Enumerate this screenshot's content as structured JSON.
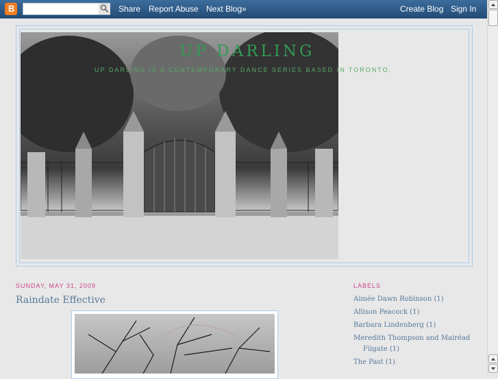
{
  "navbar": {
    "search_value": "",
    "links": [
      {
        "label": "Share"
      },
      {
        "label": "Report Abuse"
      },
      {
        "label": "Next Blog»"
      }
    ],
    "right_links": [
      {
        "label": "Create Blog"
      },
      {
        "label": "Sign In"
      }
    ],
    "logo_letter": "B"
  },
  "header": {
    "title": "UP DARLING",
    "description": "UP DARLING IS A CONTEMPORARY DANCE SERIES BASED IN TORONTO."
  },
  "post": {
    "date": "SUNDAY, MAY 31, 2009",
    "title": "Raindate Effective"
  },
  "sidebar": {
    "heading": "LABELS",
    "labels": [
      {
        "name": "Aimée Dawn Robinson",
        "count": "(1)"
      },
      {
        "name": "Allison Peacock",
        "count": "(1)"
      },
      {
        "name": "Barbara Lindenberg",
        "count": "(1)"
      },
      {
        "name": "Meredith Thompson and Mairéad",
        "name2": "Filgate",
        "count": "(1)"
      },
      {
        "name": "The Past",
        "count": "(1)"
      }
    ]
  },
  "colors": {
    "title": "#339955",
    "date": "#cc4488",
    "link": "#557799",
    "border": "#aaccee"
  }
}
